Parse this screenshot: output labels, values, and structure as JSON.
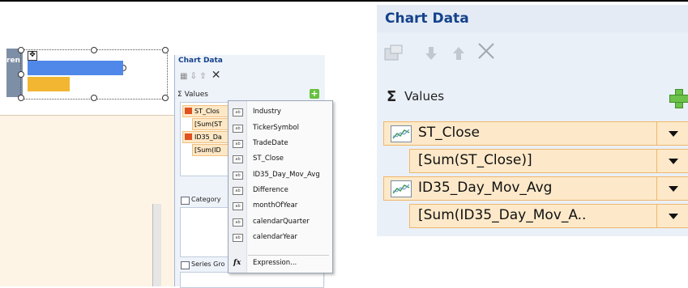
{
  "design_surface": {
    "series_label_partial": "ren",
    "bars": [
      {
        "name": "series-1-bar",
        "color": "#4f88e8"
      },
      {
        "name": "series-2-bar",
        "color": "#f2b632"
      }
    ]
  },
  "small_panel": {
    "title": "Chart Data",
    "values_label": "Values",
    "values_items": [
      {
        "field": "ST_Clos",
        "expression": "[Sum(ST"
      },
      {
        "field": "ID35_Da",
        "expression": "[Sum(ID"
      }
    ],
    "category_label": "Category",
    "series_groups_label": "Series Gro"
  },
  "field_menu": {
    "items": [
      "Industry",
      "TickerSymbol",
      "TradeDate",
      "ST_Close",
      "ID35_Day_Mov_Avg",
      "Difference",
      "monthOfYear",
      "calendarQuarter",
      "calendarYear"
    ],
    "expression_label": "Expression..."
  },
  "large_panel": {
    "title": "Chart Data",
    "values_label": "Values",
    "sigma": "Σ",
    "values_items": [
      {
        "field": "ST_Close",
        "expression": "[Sum(ST_Close)]"
      },
      {
        "field": "ID35_Day_Mov_Avg",
        "expression": "[Sum(ID35_Day_Mov_A.."
      }
    ]
  },
  "colors": {
    "accent_title": "#15428b",
    "row_fill": "#fde9c9",
    "row_border": "#f0b66a",
    "add_button": "#6cc24a"
  },
  "icons": [
    "properties-icon",
    "move-down-icon",
    "move-up-icon",
    "delete-icon",
    "add-icon",
    "line-chart-icon",
    "dropdown-arrow-icon",
    "field-icon",
    "expression-fx-icon"
  ]
}
